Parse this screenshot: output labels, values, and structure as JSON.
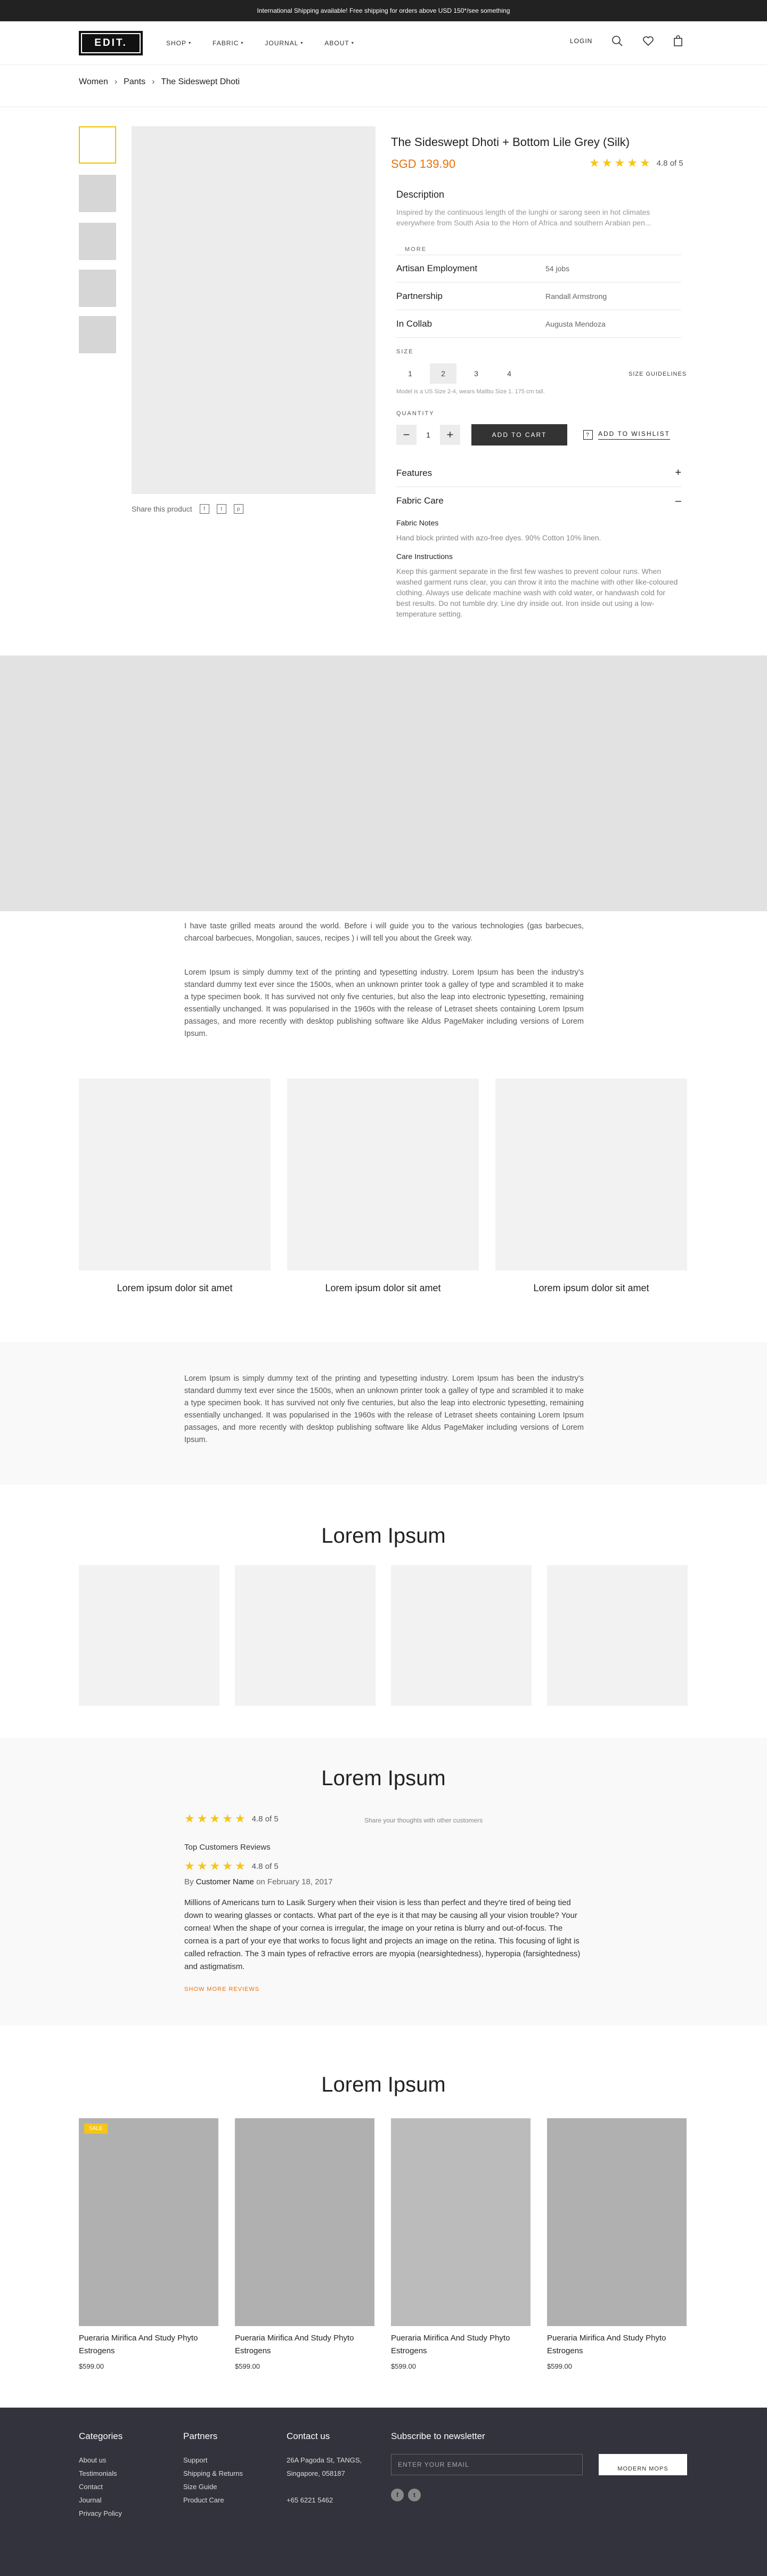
{
  "topbar": {
    "text": "International Shipping available! Free shipping for orders above USD 150*/see something"
  },
  "nav": {
    "logo": "EDIT.",
    "menu": [
      "SHOP",
      "FABRIC",
      "JOURNAL",
      "ABOUT"
    ],
    "login": "LOGIN"
  },
  "breadcrumb": [
    "Women",
    "Pants",
    "The Sideswept Dhoti"
  ],
  "product": {
    "title": "The Sideswept Dhoti + Bottom Lile Grey (Silk)",
    "price": "SGD 139.90",
    "rating_text": "4.8 of 5",
    "share_label": "Share this product",
    "description_title": "Description",
    "description": "Inspired by the continuous length of the lunghi or sarong seen in hot climates everywhere from South Asia to the Horn of Africa and southern Arabian pen...",
    "more": "MORE",
    "attributes": [
      {
        "label": "Artisan Employment",
        "value": "54 jobs"
      },
      {
        "label": "Partnership",
        "value": "Randall Armstrong"
      },
      {
        "label": "In Collab",
        "value": "Augusta Mendoza"
      }
    ],
    "size_label": "SIZE",
    "sizes": [
      "1",
      "2",
      "3",
      "4"
    ],
    "selected_size": "2",
    "size_guidelines": "SIZE GUIDELINES",
    "model_note": "Model is a US Size 2-4, wears Malibu Size 1. 175 cm tall.",
    "quantity_label": "QUANTITY",
    "quantity": "1",
    "add_to_cart": "ADD TO CART",
    "add_to_wishlist": "ADD TO WISHLIST",
    "features_title": "Features",
    "fabric_care_title": "Fabric Care",
    "fabric_notes_title": "Fabric Notes",
    "fabric_notes": "Hand block printed with azo-free dyes. 90% Cotton 10% linen.",
    "care_title": "Care Instructions",
    "care": "Keep this garment separate in the first few washes to prevent colour runs. When washed garment runs clear, you can throw it into the machine with other like-coloured clothing. Always use delicate machine wash with cold water, or handwash cold for best results. Do not tumble dry. Line dry inside out. Iron inside out using a low-temperature setting."
  },
  "story": {
    "intro": "I have taste grilled meats around the world. Before i will guide you to the various technologies (gas barbecues, charcoal barbecues, Mongolian, sauces, recipes ) i will tell you about the Greek way.",
    "body": "Lorem Ipsum is simply dummy text of the printing and typesetting industry. Lorem Ipsum has been the industry's standard dummy text ever since the 1500s, when an unknown printer took a galley of type and scrambled it to make a type specimen book. It has survived not only five centuries, but also the leap into electronic typesetting, remaining essentially unchanged. It was popularised in the 1960s with the release of Letraset sheets containing Lorem Ipsum passages, and more recently with desktop publishing software like Aldus PageMaker including versions of Lorem Ipsum.",
    "tiles": [
      "Lorem ipsum dolor sit amet",
      "Lorem ipsum dolor sit amet",
      "Lorem ipsum dolor sit amet"
    ],
    "band_text": "Lorem Ipsum is simply dummy text of the printing and typesetting industry. Lorem Ipsum has been the industry's standard dummy text ever since the 1500s, when an unknown printer took a galley of type and scrambled it to make a type specimen book. It has survived not only five centuries, but also the leap into electronic typesetting, remaining essentially unchanged. It was popularised in the 1960s with the release of Letraset sheets containing Lorem Ipsum passages, and more recently with desktop publishing software like Aldus PageMaker including versions of Lorem Ipsum."
  },
  "gallery_title": "Lorem Ipsum",
  "reviews": {
    "title": "Lorem Ipsum",
    "rating_text": "4.8 of 5",
    "share_text": "Share your thoughts with other customers",
    "top_title": "Top Customers Reviews",
    "review_rating": "4.8 of 5",
    "by": "By",
    "author": "Customer Name",
    "date": "on February 18, 2017",
    "text": "Millions of Americans turn to Lasik Surgery when their vision is less than perfect and they're tired of being tied down to wearing glasses or contacts. What part of the eye is it that may be causing all your vision trouble? Your cornea! When the shape of your cornea is irregular, the image on your retina is blurry and out-of-focus. The cornea is a part of your eye that works to focus light and projects an image on the retina. This focusing of light is called refraction. The 3 main types of refractive errors are myopia (nearsightedness), hyperopia (farsightedness) and astigmatism.",
    "show_more": "SHOW MORE REVIEWS"
  },
  "related": {
    "title": "Lorem Ipsum",
    "sale_badge": "SALE",
    "products": [
      {
        "name": "Pueraria Mirifica And Study Phyto Estrogens",
        "price": "$599.00"
      },
      {
        "name": "Pueraria Mirifica And Study Phyto Estrogens",
        "price": "$599.00"
      },
      {
        "name": "Pueraria Mirifica And Study Phyto Estrogens",
        "price": "$599.00"
      },
      {
        "name": "Pueraria Mirifica And Study Phyto Estrogens",
        "price": "$599.00"
      }
    ]
  },
  "footer": {
    "categories_title": "Categories",
    "categories": [
      "About us",
      "Testimonials",
      "Contact",
      "Journal",
      "Privacy Policy"
    ],
    "partners_title": "Partners",
    "partners": [
      "Support",
      "Shipping & Returns",
      "Size Guide",
      "Product Care"
    ],
    "contact_title": "Contact us",
    "address": [
      "26A Pagoda St, TANGS,",
      "Singapore, 058187"
    ],
    "phone": "+65 6221 5462",
    "newsletter_title": "Subscribe to newsletter",
    "email_placeholder": "ENTER YOUR EMAIL",
    "subscribe": "MODERN MOPS"
  }
}
